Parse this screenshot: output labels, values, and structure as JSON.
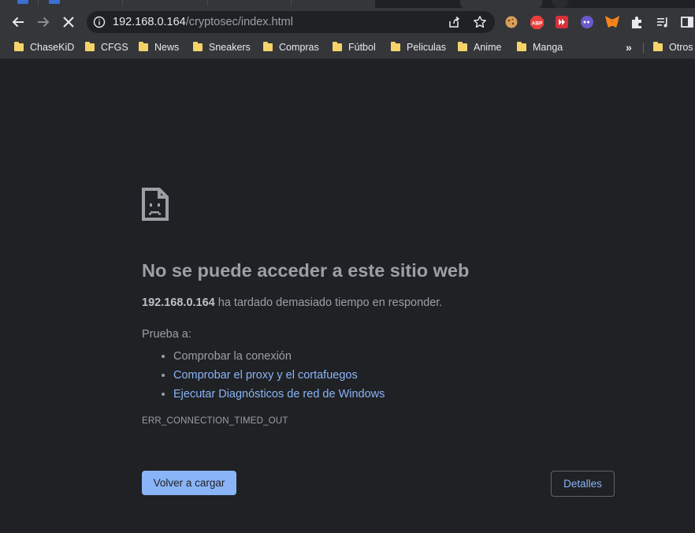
{
  "toolbar": {
    "url_host": "192.168.0.164",
    "url_path": "/cryptosec/index.html"
  },
  "extensions": [
    {
      "name": "cookie-icon"
    },
    {
      "name": "adblock-plus-icon",
      "label": "ABP",
      "color": "#e8403c"
    },
    {
      "name": "video-downloader-icon",
      "color": "#d9303a"
    },
    {
      "name": "chat-bubble-icon",
      "color": "#6a5acd"
    },
    {
      "name": "metamask-icon",
      "color": "#f6851b"
    },
    {
      "name": "puzzle-piece-icon"
    },
    {
      "name": "media-control-icon"
    },
    {
      "name": "side-panel-icon"
    }
  ],
  "bookmarks": {
    "items": [
      "ChaseKiD",
      "CFGS",
      "News",
      "Sneakers",
      "Compras",
      "Fútbol",
      "Peliculas",
      "Anime",
      "Manga"
    ],
    "overflow_label": "»",
    "other": "Otros"
  },
  "error": {
    "title": "No se puede acceder a este sitio web",
    "host": "192.168.0.164",
    "message": " ha tardado demasiado tiempo en responder.",
    "try_label": "Prueba a:",
    "suggestions": [
      "Comprobar la conexión",
      "Comprobar el proxy y el cortafuegos",
      "Ejecutar Diagnósticos de red de Windows"
    ],
    "code": "ERR_CONNECTION_TIMED_OUT",
    "reload_label": "Volver a cargar",
    "details_label": "Detalles"
  },
  "colors": {
    "page_bg": "#202124",
    "chrome_bg": "#35363a",
    "link": "#8ab4f8",
    "folder": "#f6d26a"
  }
}
